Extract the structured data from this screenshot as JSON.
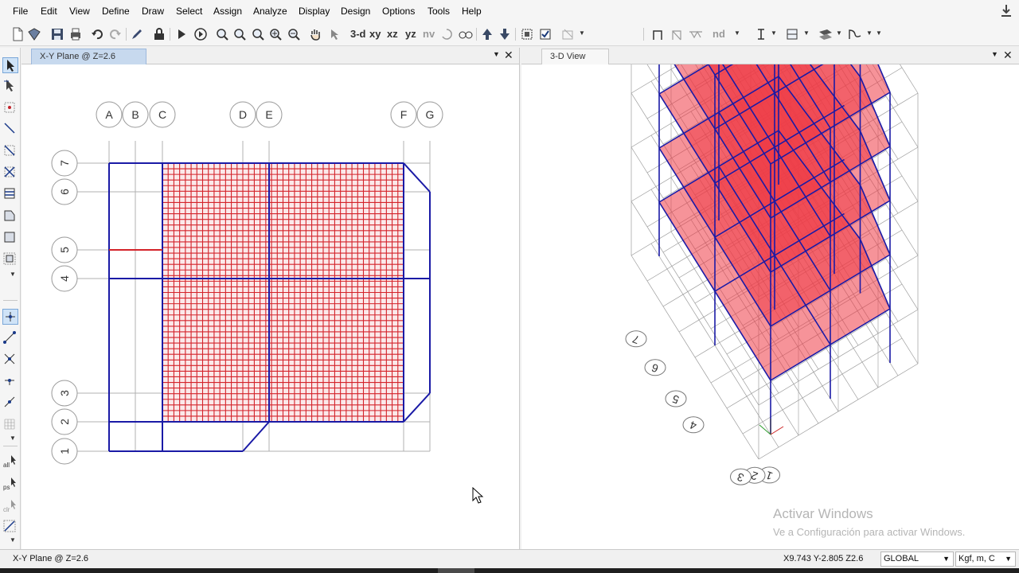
{
  "menu": [
    "File",
    "Edit",
    "View",
    "Define",
    "Draw",
    "Select",
    "Assign",
    "Analyze",
    "Display",
    "Design",
    "Options",
    "Tools",
    "Help"
  ],
  "toolbar": {
    "view_3d": "3-d",
    "view_xy": "xy",
    "view_xz": "xz",
    "view_yz": "yz",
    "view_nv": "nv",
    "view_nd": "nd"
  },
  "left_pane": {
    "tab_label": "X-Y Plane @ Z=2.6",
    "close": "✕",
    "grid_columns": [
      "A",
      "B",
      "C",
      "D",
      "E",
      "F",
      "G"
    ],
    "grid_rows": [
      "7",
      "6",
      "5",
      "4",
      "3",
      "2",
      "1"
    ]
  },
  "right_pane": {
    "tab_label": "3-D View",
    "close": "✕",
    "grid_labels": [
      "1",
      "2",
      "3",
      "4",
      "5",
      "6",
      "7"
    ]
  },
  "watermark": {
    "line1": "Activar Windows",
    "line2": "Ve a Configuración para activar Windows."
  },
  "status": {
    "view_label": "X-Y Plane @ Z=2.6",
    "coordinates": "X9.743  Y-2.805  Z2.6",
    "coord_system": "GLOBAL",
    "units": "Kgf, m, C"
  },
  "colors": {
    "frame": "#1a1aa6",
    "slab_mesh": "#d4232a",
    "slab_fill": "#ee3b45",
    "grid_line": "#9a9a9a",
    "active_tab": "#c7d9ee"
  }
}
